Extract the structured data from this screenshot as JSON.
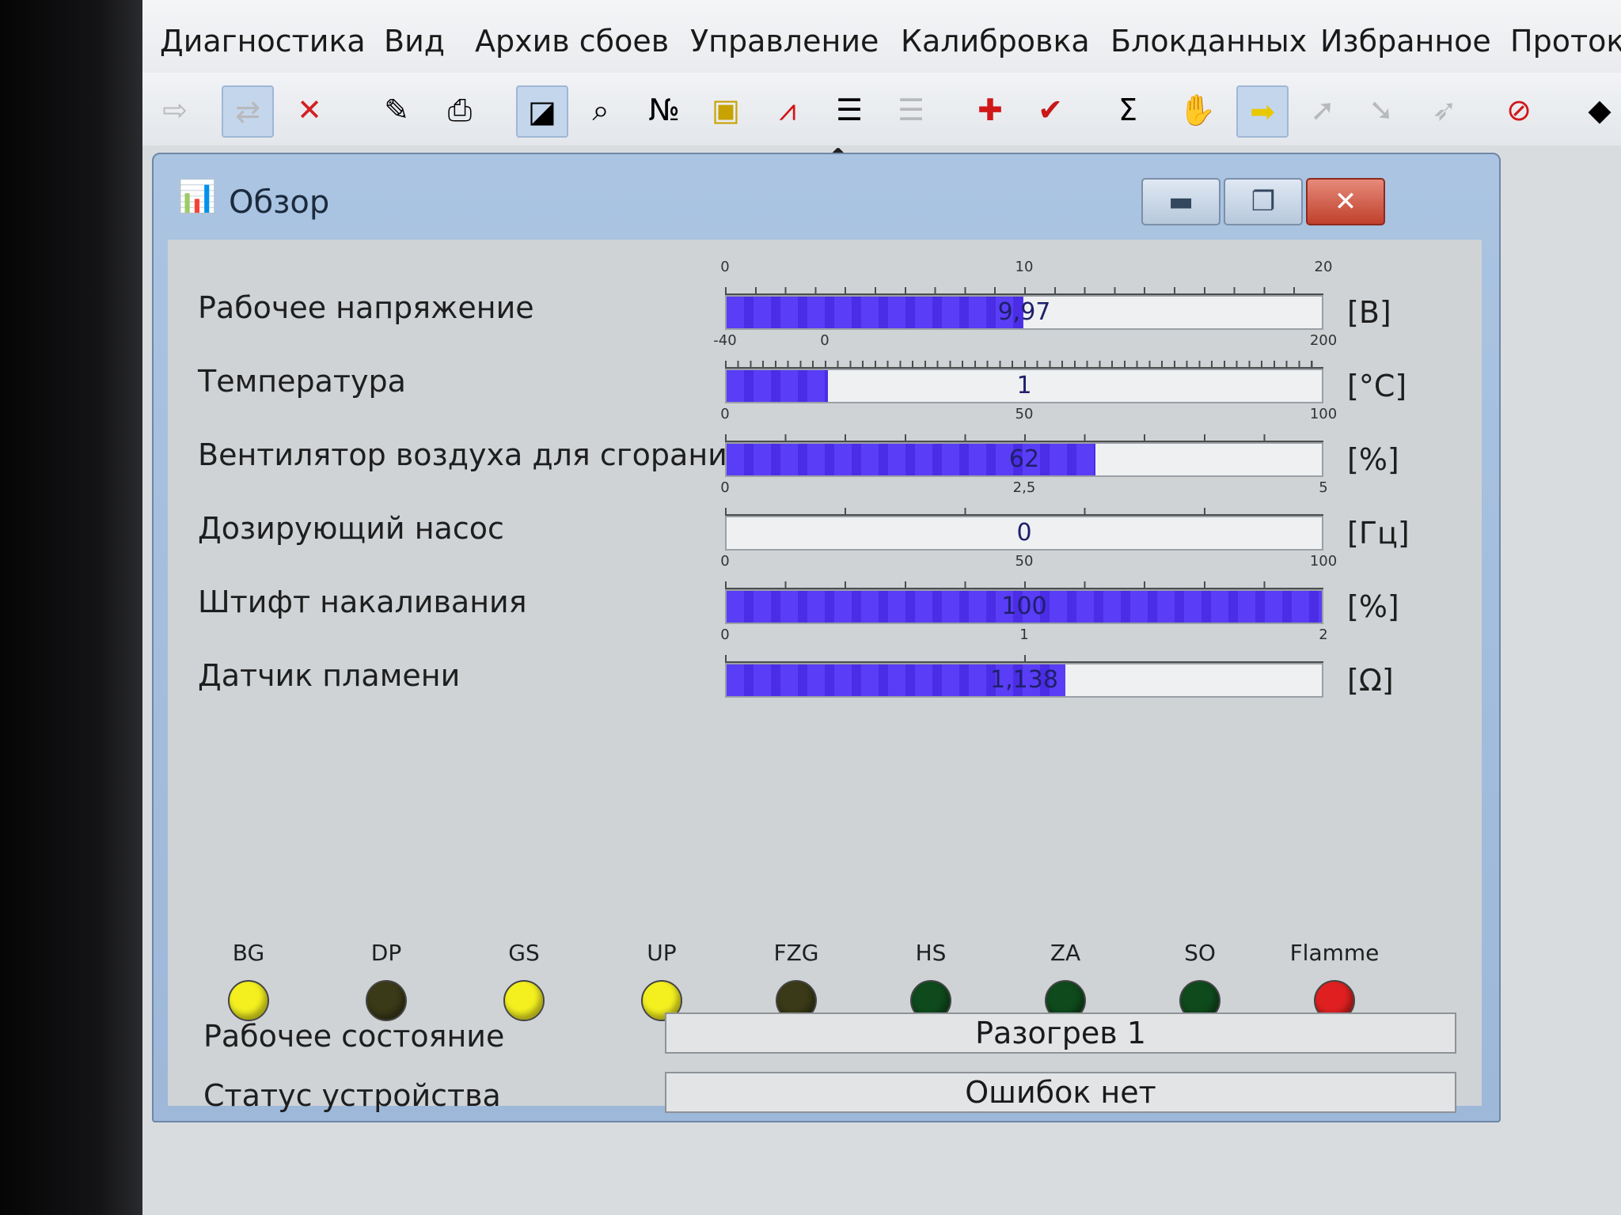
{
  "menu": [
    "Диагностика",
    "Вид",
    "Архив сбоев",
    "Управление",
    "Калибровка",
    "Блокданных",
    "Избранное",
    "Протоко"
  ],
  "toolbar": [
    {
      "icon": "exit-icon",
      "glyph": "⇨",
      "dim": true
    },
    {
      "icon": "connect-icon",
      "glyph": "⇄",
      "pressed": true,
      "dim": true
    },
    {
      "icon": "disconnect-icon",
      "glyph": "✕",
      "color": "#d32020"
    },
    {
      "icon": "clipboard-icon",
      "glyph": "✎"
    },
    {
      "icon": "print-icon",
      "glyph": "⎙"
    },
    {
      "icon": "overview-icon",
      "glyph": "◪",
      "pressed": true
    },
    {
      "icon": "search-icon",
      "glyph": "⌕"
    },
    {
      "icon": "numeric-icon",
      "glyph": "№"
    },
    {
      "icon": "indicator-icon",
      "glyph": "▣",
      "color": "#c8a200"
    },
    {
      "icon": "graph-icon",
      "glyph": "⩘",
      "color": "#d01818"
    },
    {
      "icon": "list-icon",
      "glyph": "☰"
    },
    {
      "icon": "list-disabled-icon",
      "glyph": "☰",
      "dim": true
    },
    {
      "icon": "add-icon",
      "glyph": "✚",
      "color": "#d01818"
    },
    {
      "icon": "checkmark-icon",
      "glyph": "✔",
      "color": "#c81818"
    },
    {
      "icon": "sum-icon",
      "glyph": "Σ"
    },
    {
      "icon": "hand-icon",
      "glyph": "✋"
    },
    {
      "icon": "arrow-right-icon",
      "glyph": "➡",
      "color": "#e8c800",
      "pressed": true
    },
    {
      "icon": "arrow-up-icon",
      "glyph": "➚",
      "dim": true
    },
    {
      "icon": "arrow-down-icon",
      "glyph": "➘",
      "dim": true
    },
    {
      "icon": "arrow-curve-icon",
      "glyph": "➶",
      "dim": true
    },
    {
      "icon": "co2-icon",
      "glyph": "⊘",
      "color": "#d01818"
    },
    {
      "icon": "chip-icon",
      "glyph": "◆"
    }
  ],
  "window": {
    "title": "Обзор"
  },
  "gauges": [
    {
      "label": "Рабочее напряжение",
      "min": 0,
      "max": 20,
      "value": 9.97,
      "display": "9,97",
      "unit": "[В]",
      "ticks": [
        {
          "v": 0,
          "t": "0"
        },
        {
          "v": 10,
          "t": "10"
        },
        {
          "v": 20,
          "t": "20"
        }
      ],
      "minor": 20
    },
    {
      "label": "Температура",
      "min": -40,
      "max": 200,
      "value": 1,
      "display": "1",
      "unit": "[°C]",
      "ticks": [
        {
          "v": -40,
          "t": "-40"
        },
        {
          "v": 0,
          "t": "0"
        },
        {
          "v": 200,
          "t": "200"
        }
      ],
      "minor": 48
    },
    {
      "label": "Вентилятор воздуха для сгорани:",
      "min": 0,
      "max": 100,
      "value": 62,
      "display": "62",
      "unit": "[%]",
      "ticks": [
        {
          "v": 0,
          "t": "0"
        },
        {
          "v": 50,
          "t": "50"
        },
        {
          "v": 100,
          "t": "100"
        }
      ],
      "minor": 10
    },
    {
      "label": "Дозирующий насос",
      "min": 0,
      "max": 5,
      "value": 0,
      "display": "0",
      "unit": "[Гц]",
      "ticks": [
        {
          "v": 0,
          "t": "0"
        },
        {
          "v": 2.5,
          "t": "2,5"
        },
        {
          "v": 5,
          "t": "5"
        }
      ],
      "minor": 5
    },
    {
      "label": "Штифт накаливания",
      "min": 0,
      "max": 100,
      "value": 100,
      "display": "100",
      "unit": "[%]",
      "ticks": [
        {
          "v": 0,
          "t": "0"
        },
        {
          "v": 50,
          "t": "50"
        },
        {
          "v": 100,
          "t": "100"
        }
      ],
      "minor": 10
    },
    {
      "label": "Датчик пламени",
      "min": 0,
      "max": 2,
      "value": 1.138,
      "display": "1,138",
      "unit": "[Ω]",
      "ticks": [
        {
          "v": 0,
          "t": "0"
        },
        {
          "v": 1,
          "t": "1"
        },
        {
          "v": 2,
          "t": "2"
        }
      ],
      "minor": 2
    }
  ],
  "leds": [
    {
      "label": "BG",
      "color": "#f4f020"
    },
    {
      "label": "DP",
      "color": "#3a3a18"
    },
    {
      "label": "GS",
      "color": "#f4f020"
    },
    {
      "label": "UP",
      "color": "#f4f020"
    },
    {
      "label": "FZG",
      "color": "#3a3a18"
    },
    {
      "label": "HS",
      "color": "#0f4a1c"
    },
    {
      "label": "ZA",
      "color": "#0f4a1c"
    },
    {
      "label": "SO",
      "color": "#0f4a1c"
    },
    {
      "label": "Flamme",
      "color": "#e02020"
    }
  ],
  "status": {
    "operating_label": "Рабочее состояние",
    "operating_value": "Разогрев 1",
    "device_label": "Статус устройства",
    "device_value": "Ошибок нет"
  },
  "colors": {
    "bar_fill": "#5a3df6",
    "window_frame": "#aac4e2",
    "close_button": "#c0402c"
  }
}
